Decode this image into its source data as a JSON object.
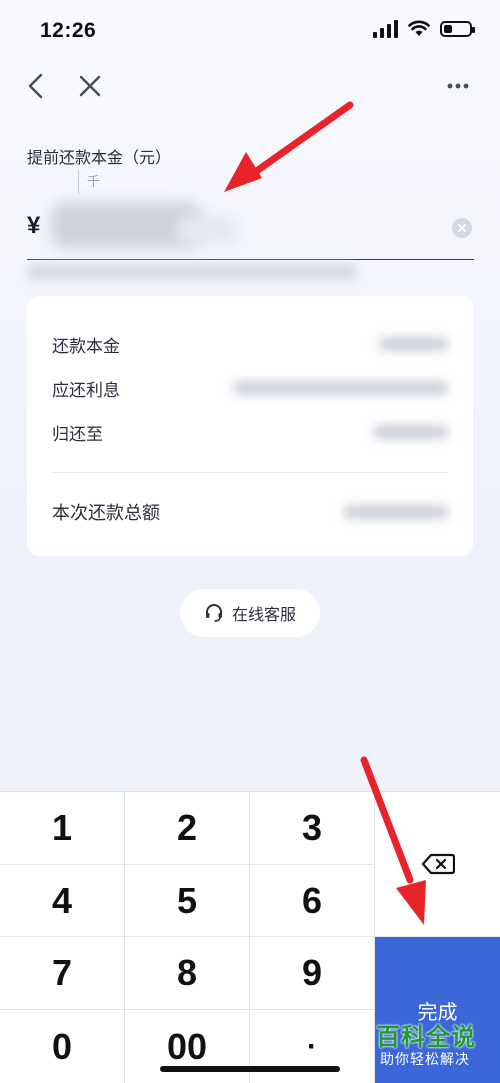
{
  "status_bar": {
    "time": "12:26",
    "battery_level": 0.35
  },
  "nav": {
    "back_icon": "chevron-left-icon",
    "close_icon": "close-icon",
    "more_icon": "more-dots-icon"
  },
  "form": {
    "amount_label": "提前还款本金（元）",
    "unit_hint": "千",
    "currency_symbol": "¥"
  },
  "details": {
    "rows": [
      {
        "label": "还款本金"
      },
      {
        "label": "应还利息"
      },
      {
        "label": "归还至"
      }
    ],
    "total_label": "本次还款总额"
  },
  "service": {
    "label": "在线客服",
    "icon": "headset-icon"
  },
  "keypad": {
    "keys": [
      "1",
      "2",
      "3",
      "4",
      "5",
      "6",
      "7",
      "8",
      "9",
      "0",
      "00",
      "·"
    ],
    "delete_icon": "backspace-icon",
    "done_label": "完成"
  },
  "watermark": {
    "main": "百科全说",
    "sub": "助你轻松解决"
  },
  "colors": {
    "accent": "#3b67d8",
    "annotation": "#e8232a",
    "watermark": "#1e9a3b"
  }
}
